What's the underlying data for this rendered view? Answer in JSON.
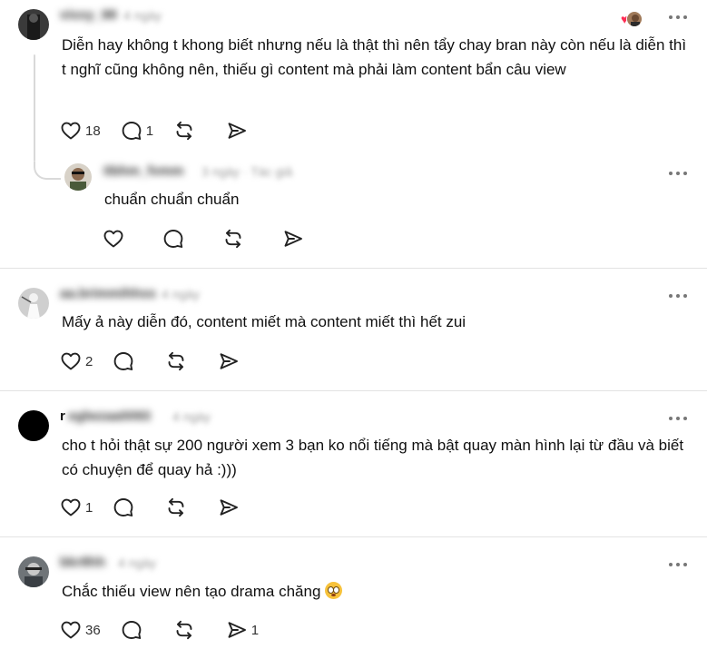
{
  "posts": [
    {
      "text": "Diễn hay không t khong biết nhưng nếu là thật thì nên tẩy chay bran này còn nếu là diễn thì t nghĩ cũng không nên, thiếu   gì content mà phải làm content bẩn câu view",
      "likes": "18",
      "comments": "1",
      "reposts": "",
      "shares": "",
      "reply": {
        "text": "chuẩn chuẩn chuẩn",
        "likes": "",
        "comments": "",
        "reposts": "",
        "shares": ""
      }
    },
    {
      "text": "Mấy ả này diễn đó, content miết mà content miết thì hết zui",
      "likes": "2",
      "comments": "",
      "reposts": "",
      "shares": ""
    },
    {
      "username_prefix": "r",
      "text": "cho t hỏi thật sự 200 người xem 3 bạn ko nổi tiếng mà bật quay màn hình lại từ đầu và biết có chuyện để quay hả :)))",
      "likes": "1",
      "comments": "",
      "reposts": "",
      "shares": ""
    },
    {
      "text": "Chắc thiếu view nên tạo drama chăng",
      "likes": "36",
      "comments": "",
      "reposts": "",
      "shares": "1"
    }
  ],
  "colors": {
    "like_badge": "#ff2d55",
    "divider": "#e3e3e3",
    "thread_line": "#d9d9d9"
  },
  "icons": [
    "heart-icon",
    "comment-icon",
    "repost-icon",
    "share-icon",
    "more-icon"
  ]
}
